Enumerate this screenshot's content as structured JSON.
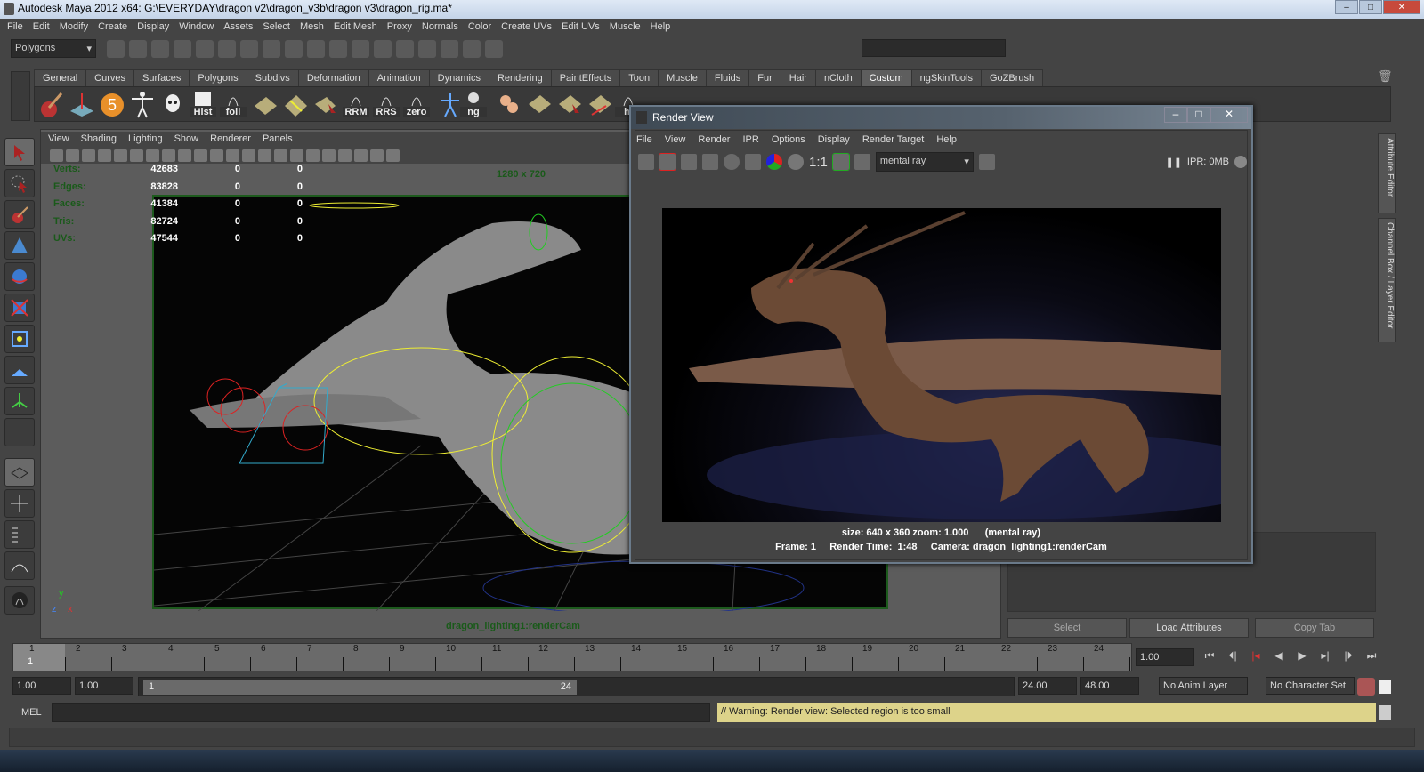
{
  "window": {
    "title": "Autodesk Maya 2012 x64: G:\\EVERYDAY\\dragon v2\\dragon_v3b\\dragon v3\\dragon_rig.ma*",
    "min": "‒",
    "max": "□",
    "close": "✕"
  },
  "menubar": [
    "File",
    "Edit",
    "Modify",
    "Create",
    "Display",
    "Window",
    "Assets",
    "Select",
    "Mesh",
    "Edit Mesh",
    "Proxy",
    "Normals",
    "Color",
    "Create UVs",
    "Edit UVs",
    "Muscle",
    "Help"
  ],
  "statusline": {
    "menuset": "Polygons"
  },
  "shelf": {
    "tabs": [
      "General",
      "Curves",
      "Surfaces",
      "Polygons",
      "Subdivs",
      "Deformation",
      "Animation",
      "Dynamics",
      "Rendering",
      "PaintEffects",
      "Toon",
      "Muscle",
      "Fluids",
      "Fur",
      "Hair",
      "nCloth",
      "Custom",
      "ngSkinTools",
      "GoZBrush"
    ],
    "active": "Custom",
    "labels": {
      "hist": "Hist",
      "foli": "foli",
      "rrm": "RRM",
      "rrs": "RRS",
      "zero": "zero",
      "ng": "ng",
      "hi": "hi"
    }
  },
  "viewport": {
    "menu": [
      "View",
      "Shading",
      "Lighting",
      "Show",
      "Renderer",
      "Panels"
    ],
    "hud": [
      {
        "k": "Verts:",
        "v": "42683",
        "a": "0",
        "b": "0"
      },
      {
        "k": "Edges:",
        "v": "83828",
        "a": "0",
        "b": "0"
      },
      {
        "k": "Faces:",
        "v": "41384",
        "a": "0",
        "b": "0"
      },
      {
        "k": "Tris:",
        "v": "82724",
        "a": "0",
        "b": "0"
      },
      {
        "k": "UVs:",
        "v": "47544",
        "a": "0",
        "b": "0"
      }
    ],
    "resolution": "1280 x 720",
    "camera": "dragon_lighting1:renderCam",
    "axis": {
      "y": "y",
      "z": "z",
      "x": "x"
    }
  },
  "renderview": {
    "title": "Render View",
    "menu": [
      "File",
      "View",
      "Render",
      "IPR",
      "Options",
      "Display",
      "Render Target",
      "Help"
    ],
    "ratio": "1:1",
    "renderer": "mental ray",
    "ipr": "IPR: 0MB",
    "info1": "size: 640 x 360 zoom: 1.000      (mental ray)",
    "info2": "Frame: 1     Render Time:  1:48     Camera: dragon_lighting1:renderCam"
  },
  "attr": {
    "select": "Select",
    "load": "Load Attributes",
    "copy": "Copy Tab",
    "tabs": [
      "Attribute Editor",
      "Channel Box / Layer Editor"
    ]
  },
  "timeline": {
    "frames": [
      "1",
      "2",
      "3",
      "4",
      "5",
      "6",
      "7",
      "8",
      "9",
      "10",
      "11",
      "12",
      "13",
      "14",
      "15",
      "16",
      "17",
      "18",
      "19",
      "20",
      "21",
      "22",
      "23",
      "24"
    ],
    "current": "1",
    "current_field": "1.00"
  },
  "range": {
    "start": "1.00",
    "start2": "1.00",
    "slider_start": "1",
    "slider_end": "24",
    "end": "24.00",
    "end2": "48.00",
    "anim_layer": "No Anim Layer",
    "char_set": "No Character Set"
  },
  "command": {
    "label": "MEL",
    "result": "// Warning: Render view: Selected region is too small"
  },
  "colors": {
    "accent": "#5e5e5e",
    "hud_green": "#1a5a1a",
    "warning_bg": "#ddd38a"
  }
}
